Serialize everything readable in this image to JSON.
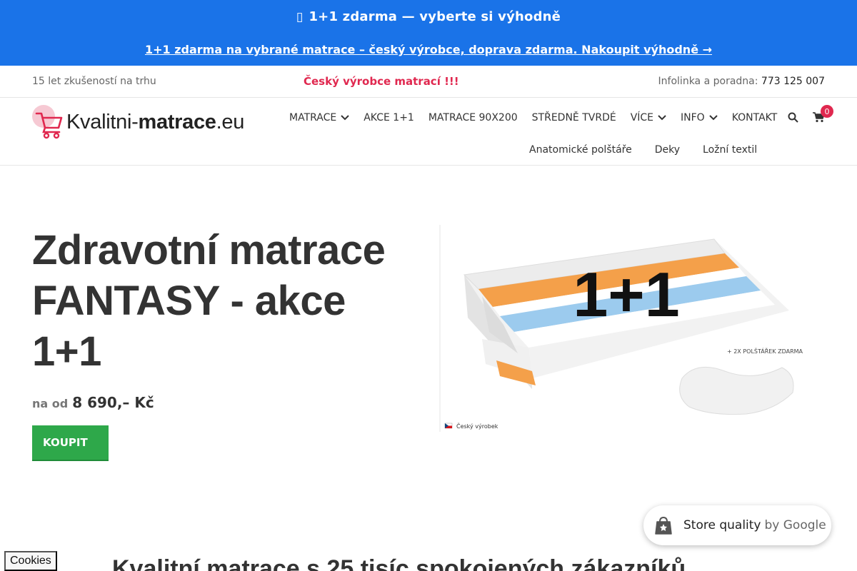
{
  "promo_top": {
    "icon": "gift-icon",
    "text": "1+1 zdarma — vyberte si výhodně"
  },
  "promo_bar": {
    "text": "1+1 zdarma na vybrané matrace – český výrobce, doprava zdarma. Nakoupit výhodně →"
  },
  "info_bar": {
    "left": "15 let zkušeností na trhu",
    "center": "Český výrobce matrací !!!",
    "right_label": "Infolinka a poradna:",
    "phone": "773 125 007"
  },
  "logo": {
    "prefix": "Kvalitni-",
    "bold": "matrace",
    "suffix": ".eu"
  },
  "nav": {
    "items": [
      {
        "label": "MATRACE",
        "dropdown": true
      },
      {
        "label": "AKCE 1+1",
        "dropdown": false
      },
      {
        "label": "MATRACE 90X200",
        "dropdown": false
      },
      {
        "label": "STŘEDNĚ TVRDÉ",
        "dropdown": false
      },
      {
        "label": "VÍCE",
        "dropdown": true
      },
      {
        "label": "INFO",
        "dropdown": true
      },
      {
        "label": "KONTAKT",
        "dropdown": false
      }
    ],
    "sub_items": [
      "Anatomické polštáře",
      "Deky",
      "Ložní textil"
    ],
    "cart_count": "0"
  },
  "hero": {
    "title_line1": "Zdravotní matrace",
    "title_line2": "FANTASY - akce",
    "title_line3": "1+1",
    "price_label": "na od",
    "price_value": "8 690,– Kč",
    "buy_label": "KOUPIT"
  },
  "product_image": {
    "badge": "1+1",
    "note": "+ 2X POLŠTÁŘEK ZDARMA",
    "origin": "Český výrobek"
  },
  "store_badge": {
    "label": "Store quality",
    "by": "by Google"
  },
  "cookies": {
    "label": "Cookies"
  },
  "section": {
    "title": "Kvalitní matrace s 25 tisíc spokojených zákazníků"
  },
  "colors": {
    "brand_blue": "#1a73e8",
    "accent_red": "#e0284f",
    "buy_green": "#2ea84a"
  }
}
